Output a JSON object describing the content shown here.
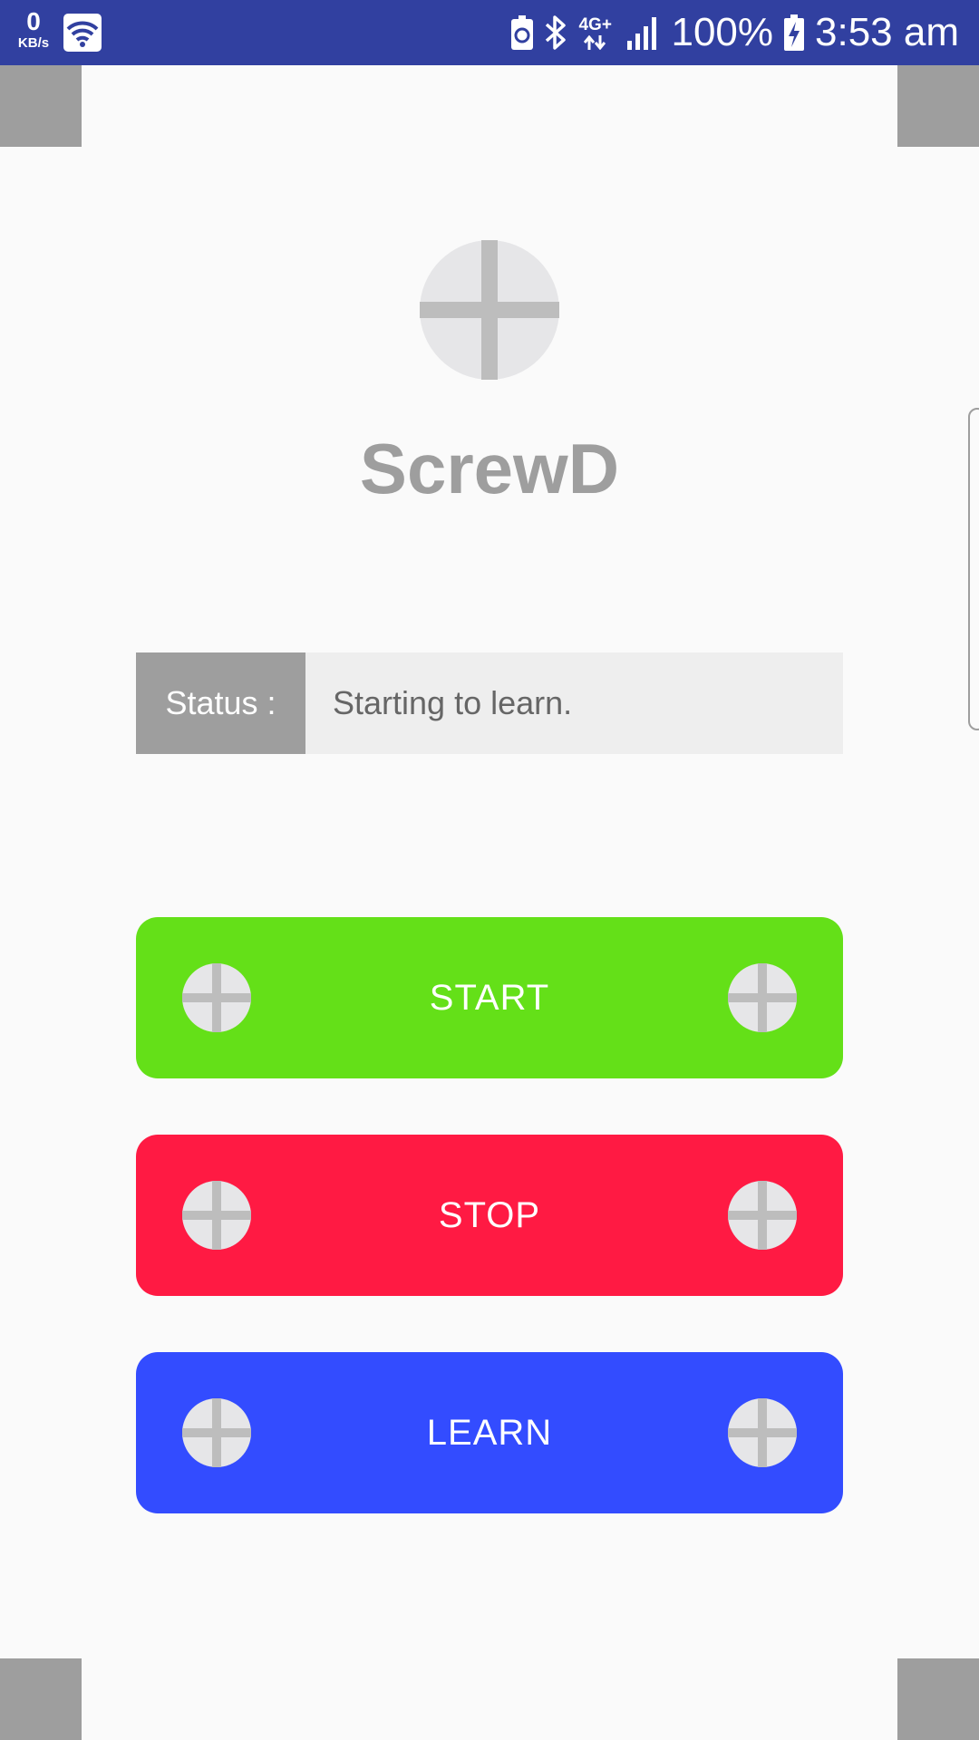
{
  "status_bar": {
    "speed_value": "0",
    "speed_unit": "KB/s",
    "network": "4G+",
    "battery": "100%",
    "time": "3:53 am"
  },
  "app": {
    "name": "ScrewD",
    "logo_icon": "screw-icon"
  },
  "status": {
    "label": "Status :",
    "value": "Starting to learn."
  },
  "buttons": [
    {
      "label": "START",
      "color": "#64e018"
    },
    {
      "label": "STOP",
      "color": "#ff1a43"
    },
    {
      "label": "LEARN",
      "color": "#334cff"
    }
  ],
  "colors": {
    "status_bar": "#3140a0",
    "background": "#fafafa",
    "accent_gray": "#9e9e9e",
    "status_field": "#eeeeee"
  }
}
